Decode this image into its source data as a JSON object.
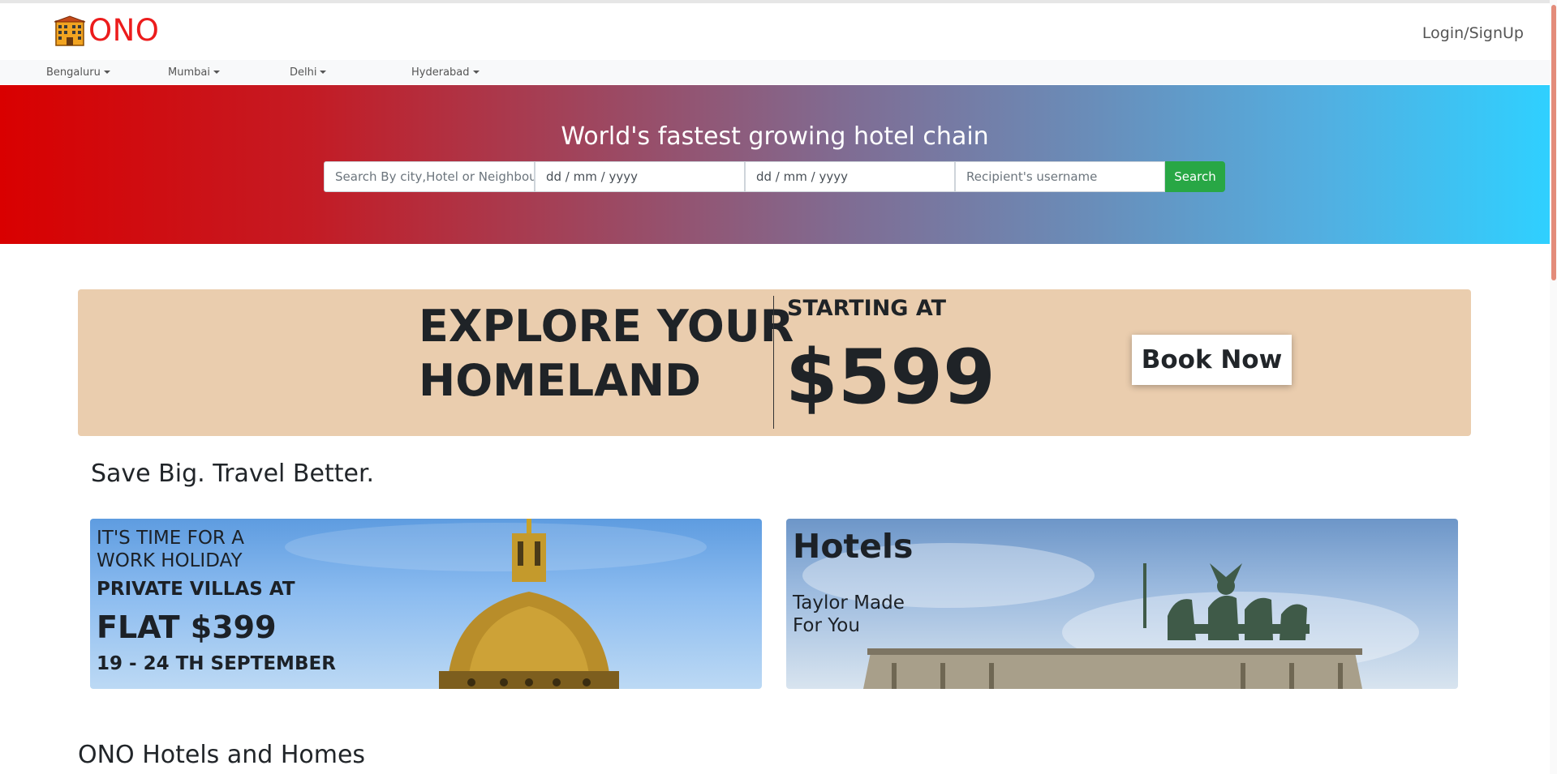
{
  "brand": {
    "name": "ONO"
  },
  "header": {
    "login_label": "Login/SignUp"
  },
  "cities": [
    "Bengaluru",
    "Mumbai",
    "Delhi",
    "Hyderabad"
  ],
  "hero": {
    "title": "World's fastest growing hotel chain",
    "search": {
      "location_placeholder": "Search By city,Hotel or Neighbourhood",
      "checkin_placeholder": "dd / mm / yyyy",
      "checkout_placeholder": "dd / mm / yyyy",
      "guest_placeholder": "Recipient's username",
      "button_label": "Search"
    }
  },
  "promo": {
    "line1": "EXPLORE YOUR",
    "line2": "HOMELAND",
    "starting_label": "STARTING AT",
    "price": "$599",
    "book_label": "Book Now"
  },
  "save_title": "Save Big. Travel Better.",
  "cards": {
    "holiday": {
      "line1": "IT'S TIME FOR A",
      "line2": "WORK HOLIDAY",
      "line3": "PRIVATE VILLAS AT",
      "line4": "FLAT $399",
      "line5": "19 - 24 TH SEPTEMBER"
    },
    "hotels": {
      "title": "Hotels",
      "line1": "Taylor Made",
      "line2": "For You"
    }
  },
  "section_title": "ONO Hotels and Homes",
  "colors": {
    "brand_red": "#ec1c1c",
    "search_green": "#28a745",
    "promo_bg": "#eacdae"
  }
}
